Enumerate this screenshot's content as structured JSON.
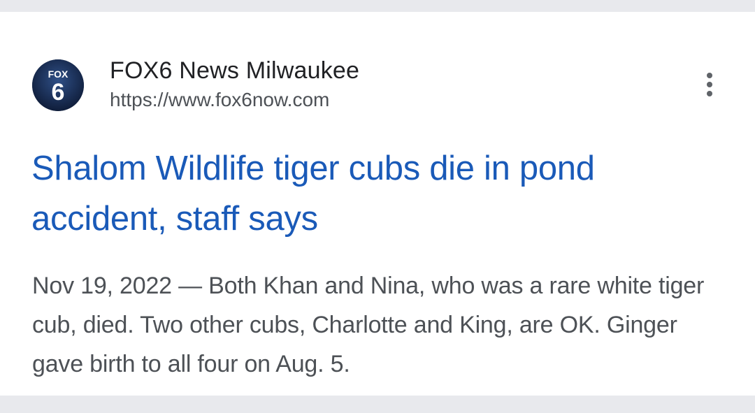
{
  "result": {
    "favicon": {
      "icon": "fox6-logo-icon",
      "text_top": "FOX",
      "text_main": "6",
      "bg_color": "#1b2a4a"
    },
    "source_name": "FOX6 News Milwaukee",
    "source_url": "https://www.fox6now.com",
    "more_icon": "vertical-dots-icon",
    "title": "Shalom Wildlife tiger cubs die in pond accident, staff says",
    "date": "Nov 19, 2022",
    "snippet": "Both Khan and Nina, who was a rare white tiger cub, died. Two other cubs, Charlotte and King, are OK. Ginger gave birth to all four on Aug. 5.",
    "date_separator": " — ",
    "colors": {
      "title": "#1a5ab8",
      "background": "#e8e9ed",
      "card": "#ffffff"
    }
  }
}
